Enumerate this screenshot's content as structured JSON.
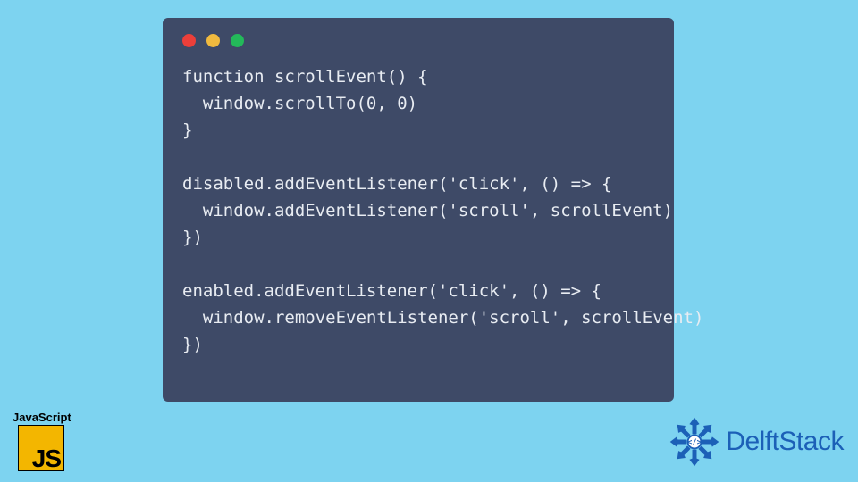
{
  "code": {
    "lines": [
      "function scrollEvent() {",
      "  window.scrollTo(0, 0)",
      "}",
      "",
      "disabled.addEventListener('click', () => {",
      "  window.addEventListener('scroll', scrollEvent)",
      "})",
      "",
      "enabled.addEventListener('click', () => {",
      "  window.removeEventListener('scroll', scrollEvent)",
      "})"
    ]
  },
  "jsBadge": {
    "label": "JavaScript",
    "letters": "JS"
  },
  "brand": {
    "name": "DelftStack"
  },
  "colors": {
    "background": "#7dd3f0",
    "card": "#3e4a67",
    "codeText": "#e8ecf2",
    "jsYellow": "#f3b600",
    "brandBlue": "#1c60b7"
  }
}
